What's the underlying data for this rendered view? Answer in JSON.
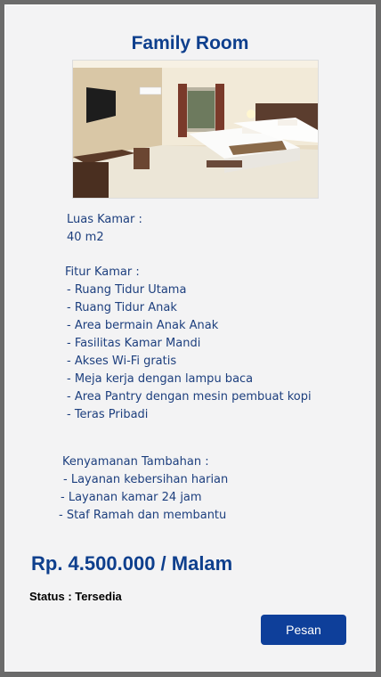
{
  "room": {
    "title": "Family Room",
    "photo_alt": "room-photo"
  },
  "size": {
    "label": "Luas Kamar :",
    "value": "40 m2"
  },
  "features": {
    "label": "Fitur Kamar :",
    "items": [
      "- Ruang Tidur Utama",
      "- Ruang Tidur Anak",
      "- Area bermain Anak Anak",
      "- Fasilitas Kamar Mandi",
      "- Akses Wi-Fi gratis",
      "- Meja kerja dengan lampu baca",
      "- Area Pantry dengan mesin pembuat kopi",
      "- Teras Pribadi"
    ]
  },
  "extras": {
    "label": "Kenyamanan Tambahan :",
    "items": [
      "- Layanan kebersihan harian",
      "- Layanan kamar 24 jam",
      "- Staf Ramah dan membantu"
    ]
  },
  "price": "Rp. 4.500.000 / Malam",
  "status": "Status : Tersedia",
  "book_button": "Pesan",
  "colors": {
    "accent": "#0e3f8d",
    "button": "#0e3f9a",
    "text": "#1d3f7e",
    "card_bg": "#f3f3f4",
    "page_bg": "#6b6b6b"
  }
}
